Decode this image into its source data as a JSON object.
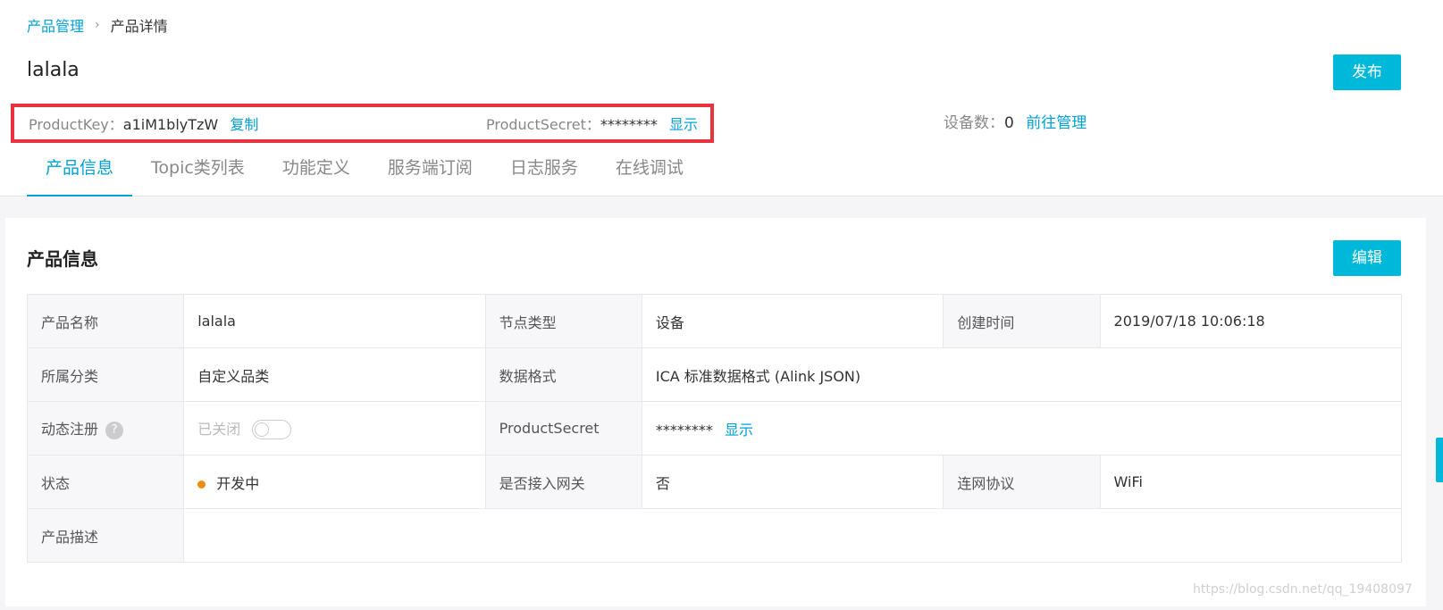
{
  "breadcrumb": {
    "parent": "产品管理",
    "separator": "›",
    "current": "产品详情"
  },
  "product": {
    "title": "lalala",
    "publish_label": "发布"
  },
  "keys": {
    "product_key_label": "ProductKey：",
    "product_key_value": "a1iM1blyTzW",
    "copy_label": "复制",
    "product_secret_label": "ProductSecret：",
    "product_secret_value": "********",
    "show_label": "显示"
  },
  "devices": {
    "label": "设备数：",
    "count": "0",
    "manage_label": "前往管理"
  },
  "tabs": [
    {
      "label": "产品信息",
      "active": true
    },
    {
      "label": "Topic类列表"
    },
    {
      "label": "功能定义"
    },
    {
      "label": "服务端订阅"
    },
    {
      "label": "日志服务"
    },
    {
      "label": "在线调试"
    }
  ],
  "info": {
    "title": "产品信息",
    "edit_label": "编辑",
    "rows": {
      "name_label": "产品名称",
      "name_value": "lalala",
      "node_label": "节点类型",
      "node_value": "设备",
      "created_label": "创建时间",
      "created_value": "2019/07/18 10:06:18",
      "category_label": "所属分类",
      "category_value": "自定义品类",
      "format_label": "数据格式",
      "format_value": "ICA 标准数据格式 (Alink JSON)",
      "dynamic_label": "动态注册",
      "dynamic_value": "已关闭",
      "secret_label": "ProductSecret",
      "secret_value": "********",
      "secret_show": "显示",
      "status_label": "状态",
      "status_value": "开发中",
      "gateway_label": "是否接入网关",
      "gateway_value": "否",
      "protocol_label": "连网协议",
      "protocol_value": "WiFi",
      "desc_label": "产品描述",
      "desc_value": ""
    }
  },
  "colors": {
    "accent": "#00b8d9",
    "link": "#00a1d6",
    "highlight_box": "#e8323c",
    "status_dot": "#f08a12"
  },
  "watermark": "https://blog.csdn.net/qq_19408097"
}
